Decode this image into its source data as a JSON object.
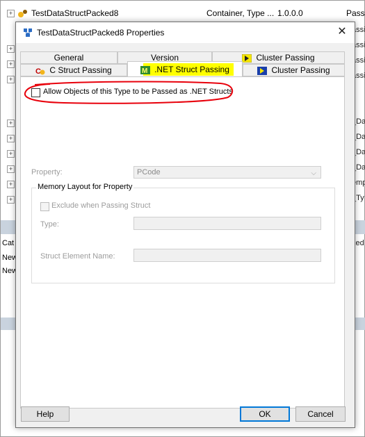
{
  "background": {
    "row": {
      "name": "TestDataStructPacked8",
      "type": "Container, Type ...",
      "version": "1.0.0.0",
      "passing": "Passi"
    },
    "right_fragments": [
      "assi",
      "assi",
      "assi",
      "assi",
      "_Da",
      "_Da",
      "_Da",
      "_Da",
      "empl",
      "_Ty"
    ],
    "left_fragments": [
      "Cat",
      "New",
      "New"
    ],
    "right_band_text": "xed"
  },
  "dialog": {
    "title": "TestDataStructPacked8 Properties",
    "close_glyph": "✕",
    "tabs_top": [
      "General",
      "Version",
      "Cluster Passing"
    ],
    "tabs_bottom": [
      "C Struct Passing",
      ".NET Struct Passing",
      "Cluster Passing"
    ],
    "allow_checkbox_label": "Allow Objects of this Type to be Passed as .NET Structs",
    "property_label": "Property:",
    "property_value": "PCode",
    "group_title": "Memory Layout for Property",
    "exclude_label": "Exclude when Passing Struct",
    "type_label": "Type:",
    "struct_element_label": "Struct Element Name:",
    "buttons": {
      "help": "Help",
      "ok": "OK",
      "cancel": "Cancel"
    }
  },
  "colors": {
    "highlight": "#ffff00",
    "annotation": "#e8000b",
    "focus": "#0078d7"
  },
  "icons": {
    "title": "properties-icon",
    "c_struct": "c-struct-icon",
    "net_struct": "dotnet-m-icon",
    "cluster": "cluster-icon"
  }
}
